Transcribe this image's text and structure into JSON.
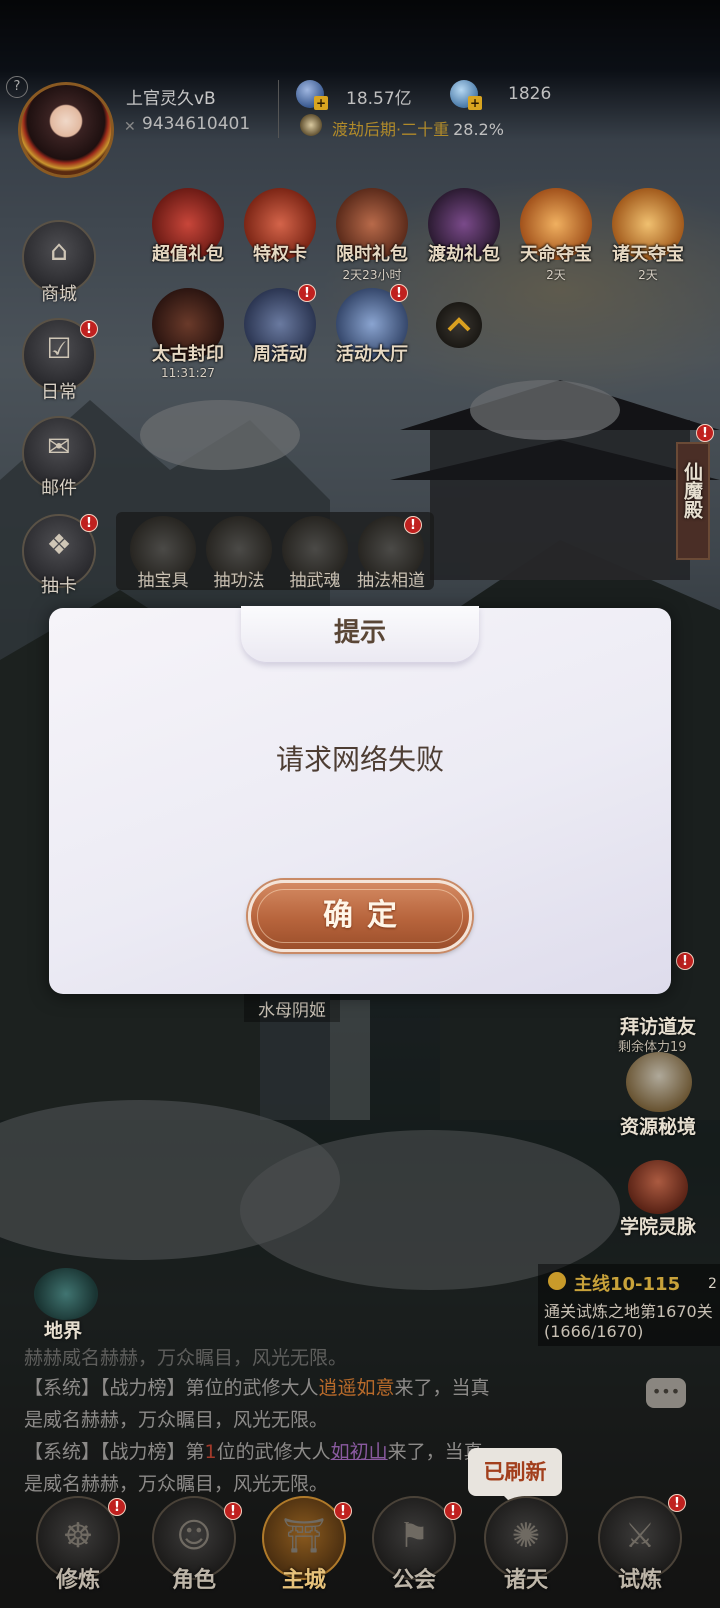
{
  "player": {
    "name": "上官灵久vB",
    "id": "9434610401",
    "currency_1": "18.57亿",
    "currency_2": "1826",
    "realm": "渡劫后期·二十重",
    "realm_progress": "28.2%",
    "help_label": "?"
  },
  "side_menu": [
    {
      "label": "商城",
      "icon": "shop-icon",
      "glyph": "⌂"
    },
    {
      "label": "日常",
      "icon": "checklist-icon",
      "glyph": "☑"
    },
    {
      "label": "邮件",
      "icon": "mail-icon",
      "glyph": "✉"
    },
    {
      "label": "抽卡",
      "icon": "card-draw-icon",
      "glyph": "❖"
    }
  ],
  "events_row1": [
    {
      "label": "超值礼包",
      "sub": "",
      "icon": "value-gift-icon"
    },
    {
      "label": "特权卡",
      "sub": "",
      "icon": "privilege-card-icon"
    },
    {
      "label": "限时礼包",
      "sub": "2天23小时",
      "icon": "timed-gift-icon"
    },
    {
      "label": "渡劫礼包",
      "sub": "",
      "icon": "tribulation-gift-icon"
    },
    {
      "label": "天命夺宝",
      "sub": "2天",
      "icon": "destiny-treasure-icon"
    },
    {
      "label": "诸天夺宝",
      "sub": "2天",
      "icon": "heavens-treasure-icon"
    }
  ],
  "events_row2": [
    {
      "label": "太古封印",
      "sub": "11:31:27",
      "icon": "ancient-seal-icon"
    },
    {
      "label": "周活动",
      "sub": "",
      "icon": "weekly-event-icon"
    },
    {
      "label": "活动大厅",
      "sub": "",
      "icon": "event-hall-icon"
    }
  ],
  "draw_panel": [
    {
      "label": "抽宝具",
      "icon": "treasure-draw-icon"
    },
    {
      "label": "抽功法",
      "icon": "technique-draw-icon"
    },
    {
      "label": "抽武魂",
      "icon": "martial-soul-draw-icon"
    },
    {
      "label": "抽法相道",
      "icon": "dharma-draw-icon"
    }
  ],
  "right_side": {
    "immortal_hall": "仙魔殿",
    "visit_friend": "拜访道友",
    "visit_remaining": "剩余体力19",
    "resource_realm": "资源秘境",
    "academy_vein": "学院灵脉",
    "npc_name": "水母阴姬",
    "earth_realm": "地界"
  },
  "quest": {
    "title": "主线10-115",
    "count": "2",
    "desc": "通关试炼之地第1670关",
    "progress": "(1666/1670)"
  },
  "chat": {
    "line0": "赫赫威名赫赫，万众瞩目，风光无限。",
    "line1_prefix": "【系统】【战力榜】第",
    "line1_mid": "位的武修大人",
    "line1_name": "逍遥如意",
    "line1_suffix": "来了，当真",
    "line2": "是威名赫赫，万众瞩目，风光无限。",
    "line3_prefix": "【系统】【战力榜】第",
    "line3_rank": "1",
    "line3_mid": "位的武修大人",
    "line3_name": "如初山",
    "line3_suffix": "来了，当真",
    "line4": "是威名赫赫，万众瞩目，风光无限。"
  },
  "refresh_bubble": "已刷新",
  "bottom_nav": [
    {
      "label": "修炼",
      "icon": "meditation-icon",
      "glyph": "☸"
    },
    {
      "label": "角色",
      "icon": "character-icon",
      "glyph": "☺"
    },
    {
      "label": "主城",
      "icon": "main-city-icon",
      "glyph": "⛩"
    },
    {
      "label": "公会",
      "icon": "guild-icon",
      "glyph": "⚑"
    },
    {
      "label": "诸天",
      "icon": "heavens-icon",
      "glyph": "✺"
    },
    {
      "label": "试炼",
      "icon": "trial-icon",
      "glyph": "⚔"
    }
  ],
  "modal": {
    "title": "提示",
    "message": "请求网络失败",
    "confirm_label": "确定"
  },
  "colors": {
    "modal_bg": "#ecebf4",
    "confirm_button": "#b7643c",
    "badge_red": "#c0211f"
  }
}
